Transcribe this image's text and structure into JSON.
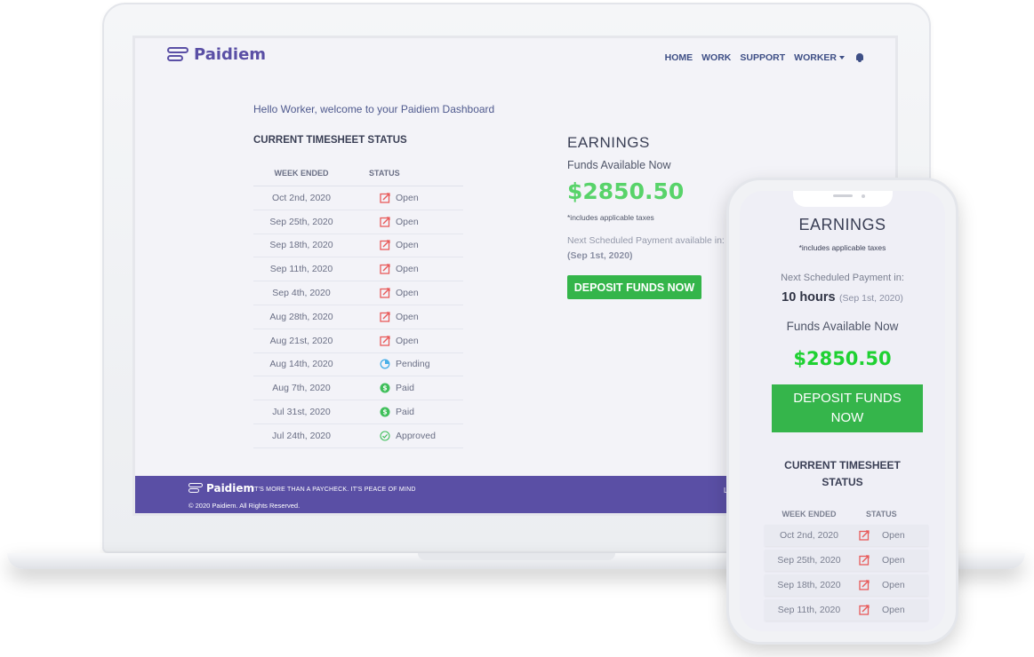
{
  "app": {
    "logo_text": "Paidiem",
    "nav": {
      "home": "HOME",
      "work": "WORK",
      "support": "SUPPORT",
      "worker": "WORKER"
    },
    "welcome": "Hello Worker, welcome to your Paidiem Dashboard"
  },
  "timesheet": {
    "title": "CURRENT TIMESHEET STATUS",
    "col_week": "WEEK ENDED",
    "col_status": "STATUS",
    "rows": [
      {
        "week": "Oct 2nd, 2020",
        "status": "Open",
        "icon": "edit-icon"
      },
      {
        "week": "Sep 25th, 2020",
        "status": "Open",
        "icon": "edit-icon"
      },
      {
        "week": "Sep 18th, 2020",
        "status": "Open",
        "icon": "edit-icon"
      },
      {
        "week": "Sep 11th, 2020",
        "status": "Open",
        "icon": "edit-icon"
      },
      {
        "week": "Sep 4th, 2020",
        "status": "Open",
        "icon": "edit-icon"
      },
      {
        "week": "Aug 28th, 2020",
        "status": "Open",
        "icon": "edit-icon"
      },
      {
        "week": "Aug 21st, 2020",
        "status": "Open",
        "icon": "edit-icon"
      },
      {
        "week": "Aug 14th, 2020",
        "status": "Pending",
        "icon": "pending-icon"
      },
      {
        "week": "Aug 7th, 2020",
        "status": "Paid",
        "icon": "dollar-icon"
      },
      {
        "week": "Jul 31st, 2020",
        "status": "Paid",
        "icon": "dollar-icon"
      },
      {
        "week": "Jul 24th, 2020",
        "status": "Approved",
        "icon": "check-circle-icon"
      }
    ]
  },
  "earnings": {
    "title": "EARNINGS",
    "funds_label": "Funds Available Now",
    "amount": "$2850.50",
    "tax_note": "*includes applicable taxes",
    "next_label": "Next Scheduled Payment available in:",
    "next_date": "(Sep 1st, 2020)",
    "deposit_button": "DEPOSIT FUNDS NOW"
  },
  "footer": {
    "logo_text": "Paidiem",
    "tagline": "IT'S MORE THAN A PAYCHECK. IT'S PEACE OF MIND",
    "copyright": "© 2020 Paidiem. All Rights Reserved.",
    "right_text": "L"
  },
  "mobile": {
    "earnings_title": "EARNINGS",
    "tax_note": "*includes applicable taxes",
    "next_label": "Next Scheduled Payment in:",
    "next_hours": "10 hours",
    "next_date": "(Sep 1st, 2020)",
    "funds_label": "Funds Available Now",
    "amount": "$2850.50",
    "deposit_button": "DEPOSIT FUNDS NOW",
    "ts_title": "CURRENT TIMESHEET STATUS",
    "col_week": "WEEK ENDED",
    "col_status": "STATUS",
    "rows": [
      {
        "week": "Oct 2nd, 2020",
        "status": "Open"
      },
      {
        "week": "Sep 25th, 2020",
        "status": "Open"
      },
      {
        "week": "Sep 18th, 2020",
        "status": "Open"
      },
      {
        "week": "Sep 11th, 2020",
        "status": "Open"
      }
    ]
  },
  "colors": {
    "brand_purple": "#5a4fa5",
    "nav_blue": "#3e4f86",
    "accent_green": "#34b54a",
    "amount_green": "#58d36a",
    "open_red": "#e85a5a",
    "pending_blue": "#4ab0e8",
    "paid_green": "#3fbf5a"
  }
}
